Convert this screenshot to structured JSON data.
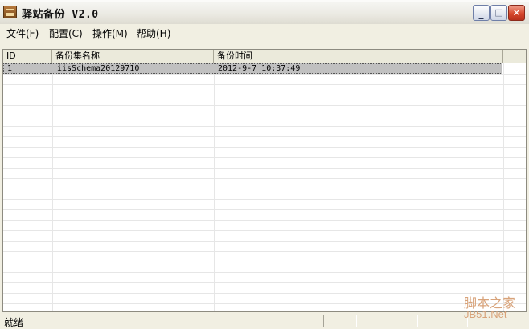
{
  "window": {
    "title": "驿站备份 V2.0",
    "minimize_glyph": "_",
    "maximize_glyph": "□",
    "close_glyph": "✕"
  },
  "menu": [
    {
      "label": "文件(F)"
    },
    {
      "label": "配置(C)"
    },
    {
      "label": "操作(M)"
    },
    {
      "label": "帮助(H)"
    }
  ],
  "table": {
    "columns": [
      "ID",
      "备份集名称",
      "备份时间",
      ""
    ],
    "rows": [
      {
        "id": "1",
        "name": "iisSchema20129710",
        "time": "2012-9-7 10:37:49",
        "selected": true
      }
    ]
  },
  "status": {
    "text": "就绪"
  },
  "watermark": {
    "cn": "脚本之家",
    "en": "JB51.Net"
  },
  "colors": {
    "selected_row": "#c0c0c0",
    "window_bg": "#f1efe2",
    "close_button": "#d6482c"
  },
  "icons": {
    "app": "backup-app-icon"
  }
}
